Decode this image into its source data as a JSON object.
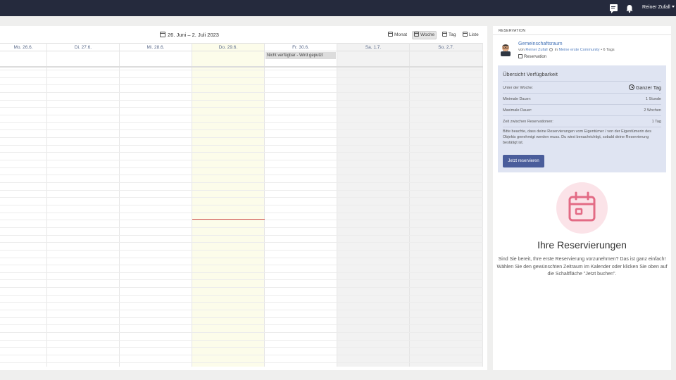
{
  "topbar": {
    "user_name": "Reiner Zufall"
  },
  "calendar": {
    "date_range": "26. Juni – 2. Juli 2023",
    "views": [
      {
        "label": "Monat",
        "active": false
      },
      {
        "label": "Woche",
        "active": true
      },
      {
        "label": "Tag",
        "active": false
      },
      {
        "label": "Liste",
        "active": false
      }
    ],
    "days": [
      {
        "label": "Mo. 26.6.",
        "kind": "normal"
      },
      {
        "label": "Di. 27.6.",
        "kind": "normal"
      },
      {
        "label": "Mi. 28.6.",
        "kind": "normal"
      },
      {
        "label": "Do. 29.6.",
        "kind": "today"
      },
      {
        "label": "Fr. 30.6.",
        "kind": "normal"
      },
      {
        "label": "Sa. 1.7.",
        "kind": "weekend"
      },
      {
        "label": "So. 2.7.",
        "kind": "weekend"
      }
    ],
    "event": {
      "label": "Nicht verfügbar - Wird geputzt",
      "day": "Fr. 30.6."
    }
  },
  "panel": {
    "header": "RESERVATION",
    "resource": {
      "title": "Gemeinschaftsraum",
      "by_prefix": "von",
      "owner": "Reiner Zufall",
      "in_prefix": "in",
      "community": "Meine erste Community",
      "tags": "• 6 Tags",
      "type": "Reservation"
    },
    "availability": {
      "title": "Übersicht Verfügbarkeit",
      "rows": [
        {
          "label": "Unter der Woche:",
          "value": "Ganzer Tag"
        },
        {
          "label": "Minimale Dauer:",
          "value": "1 Stunde"
        },
        {
          "label": "Maximale Dauer:",
          "value": "2 Wochen"
        },
        {
          "label": "Zeit zwischen Reservationen:",
          "value": "1 Tag"
        }
      ],
      "note": "Bitte beachte, dass deine Reservierungen vom Eigentümer / von der Eigentümerin des Objekts genehmigt werden muss. Du wirst benachrichtigt, sobald deine Reservierung bestätigt ist.",
      "button": "Jetzt reservieren"
    },
    "empty": {
      "title": "Ihre Reservierungen",
      "text": "Sind Sie bereit, Ihre erste Reservierung vorzunehmen? Das ist ganz einfach! Wählen Sie den gewünschten Zeitraum im Kalender oder klicken Sie oben auf die Schaltfläche \"Jetzt buchen\"."
    }
  },
  "colors": {
    "topbar": "#252a3d",
    "accent": "#4a5d9b",
    "link": "#3f6fb5",
    "today": "#fcfcea",
    "now_line": "#d6493a",
    "empty_icon": "#e36b85"
  }
}
